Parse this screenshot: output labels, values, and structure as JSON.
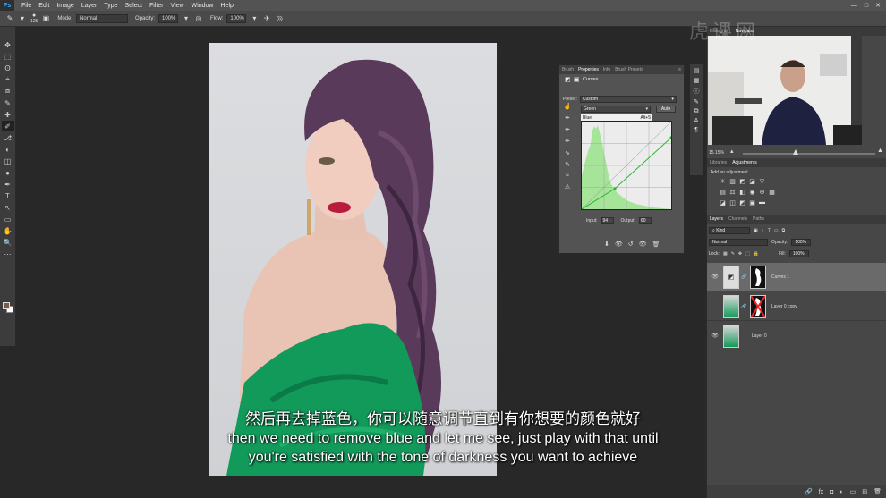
{
  "app": {
    "logo": "Ps"
  },
  "menu": [
    "File",
    "Edit",
    "Image",
    "Layer",
    "Type",
    "Select",
    "Filter",
    "View",
    "Window",
    "Help"
  ],
  "window_controls": [
    "—",
    "□",
    "✕"
  ],
  "options_bar": {
    "brush_size": "125",
    "mode_label": "Mode:",
    "mode_value": "Normal",
    "opacity_label": "Opacity:",
    "opacity_value": "100%",
    "flow_label": "Flow:",
    "flow_value": "100%"
  },
  "tools": [
    "✥",
    "⬚",
    "ʘ",
    "⌖",
    "⧈",
    "✎",
    "✚",
    "✐",
    "⎇",
    "◐",
    "◫",
    "●",
    "✒",
    "T",
    "↖",
    "▭",
    "✋",
    "🔍",
    "⋯"
  ],
  "properties": {
    "tabs": [
      "Brush",
      "Properties",
      "Info",
      "Brush Presets"
    ],
    "active_tab": "Properties",
    "title": "Curves",
    "preset_label": "Preset:",
    "preset_value": "Custom",
    "channel_value": "Green",
    "auto_label": "Auto",
    "dropdown_item": "Blue",
    "dropdown_shortcut": "Alt+5",
    "input_label": "Input:",
    "input_value": "94",
    "output_label": "Output:",
    "output_value": "60"
  },
  "navigator": {
    "tabs": [
      "Histogram",
      "Navigator"
    ],
    "active_tab": "Navigator",
    "zoom": "15.15%"
  },
  "adjustments": {
    "tabs": [
      "Libraries",
      "Adjustments"
    ],
    "active_tab": "Adjustments",
    "title": "Add an adjustment"
  },
  "layers": {
    "tabs": [
      "Layers",
      "Channels",
      "Paths"
    ],
    "active_tab": "Layers",
    "kind_label": "Kind",
    "blend_mode": "Normal",
    "opacity_label": "Opacity:",
    "opacity_value": "100%",
    "lock_label": "Lock:",
    "fill_label": "Fill:",
    "fill_value": "100%",
    "items": [
      {
        "name": "Curves 1",
        "visible": true
      },
      {
        "name": "Layer 0 copy",
        "visible": false
      },
      {
        "name": "Layer 0",
        "visible": true
      }
    ]
  },
  "subtitles": {
    "cn": "然后再去掉蓝色，你可以随意调节直到有你想要的颜色就好",
    "en1": "then we need to remove blue and let me see, just play with that until",
    "en2": "you're satisfied with the tone of darkness you want to achieve"
  },
  "watermark": "虎课网",
  "colors": {
    "histogram": "#a6e49a",
    "curve_line": "#2bb52b",
    "dress": "#129a5a",
    "hair": "#5a3a5a",
    "lips": "#b81c3c"
  }
}
